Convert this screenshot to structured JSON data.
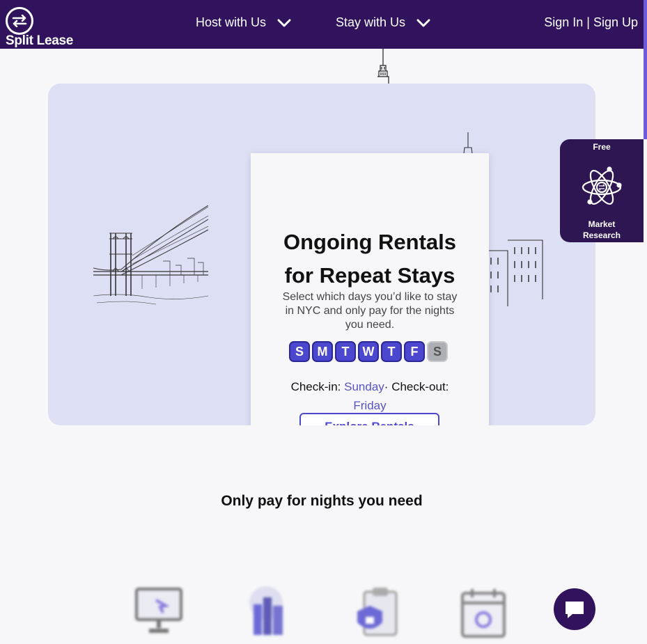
{
  "nav": {
    "logo_text": "Split Lease",
    "host_label": "Host with Us",
    "stay_label": "Stay with Us",
    "sign_in": "Sign In",
    "separator": " | ",
    "sign_up": "Sign Up"
  },
  "hero": {
    "title_line1": "Ongoing Rentals",
    "title_line2": "for Repeat Stays",
    "subtitle": "Select which days you’d like to stay in NYC and only pay for the nights you need.",
    "days": [
      {
        "letter": "S",
        "selected": true
      },
      {
        "letter": "M",
        "selected": true
      },
      {
        "letter": "T",
        "selected": true
      },
      {
        "letter": "W",
        "selected": true
      },
      {
        "letter": "T",
        "selected": true
      },
      {
        "letter": "F",
        "selected": true
      },
      {
        "letter": "S",
        "selected": false
      }
    ],
    "checkin_label": "Check-in:",
    "checkin_value": "Sunday",
    "dot": "·",
    "checkout_label": "Check-out:",
    "checkout_value": "Friday",
    "explore_label": "Explore Rentals"
  },
  "market": {
    "free": "Free",
    "label_line1": "Market",
    "label_line2": "Research"
  },
  "section": {
    "title": "Only pay for nights you need"
  },
  "colors": {
    "nav_bg": "#31135d",
    "accent": "#4b47ce",
    "hero_bg": "#dddff5"
  },
  "icons": [
    "exchange-arrows-icon",
    "chevron-down-icon",
    "atom-icon",
    "computer-icon",
    "buildings-icon",
    "lock-clipboard-icon",
    "calendar-icon",
    "chat-icon"
  ]
}
